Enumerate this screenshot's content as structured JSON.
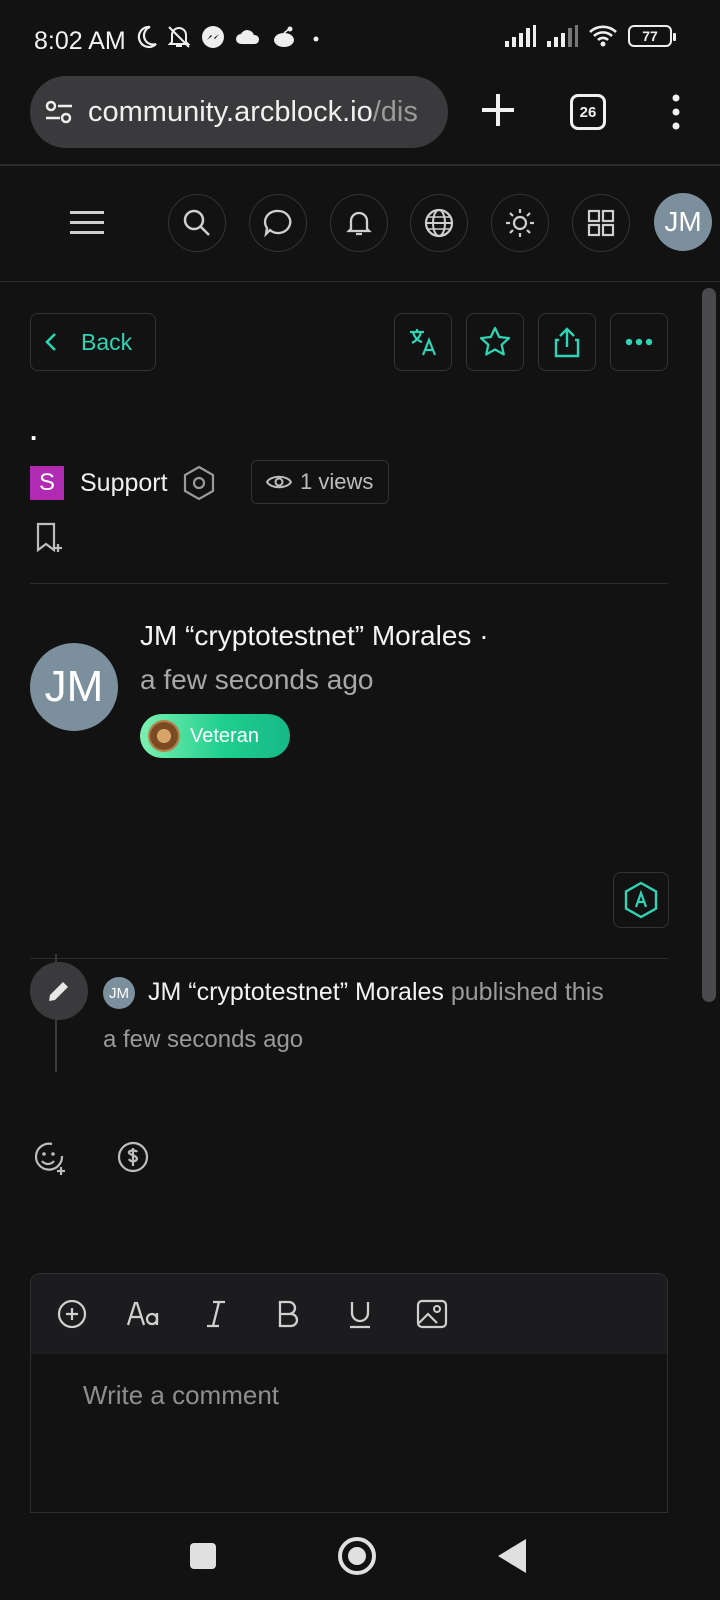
{
  "status_bar": {
    "time": "8:02 AM",
    "battery": "77",
    "icons": [
      "moon-icon",
      "bell-off-icon",
      "messenger-icon",
      "cloud-icon",
      "reddit-icon",
      "dot-icon",
      "signal-icon",
      "signal-icon",
      "wifi-icon",
      "battery-icon"
    ]
  },
  "browser": {
    "url_main": "community.arcblock.io",
    "url_path": "/dis",
    "tab_count": "26"
  },
  "header": {
    "avatar_initials": "JM",
    "icons": [
      "menu-icon",
      "search-icon",
      "chat-icon",
      "bell-icon",
      "globe-icon",
      "sun-icon",
      "apps-icon"
    ]
  },
  "actions": {
    "back_label": "Back",
    "icons": [
      "translate-icon",
      "star-icon",
      "share-icon",
      "more-icon"
    ]
  },
  "post": {
    "title": ".",
    "category_letter": "S",
    "category_name": "Support",
    "views": "1 views"
  },
  "author": {
    "initials": "JM",
    "name": "JM “cryptotestnet” Morales ·",
    "time": "a few seconds ago",
    "badge": "Veteran"
  },
  "timeline": {
    "avatar_initials": "JM",
    "actor": "JM “cryptotestnet” Morales",
    "action": " published this",
    "time": "a few seconds ago"
  },
  "editor": {
    "placeholder": "Write a comment",
    "tools": [
      "add-icon",
      "font-size-icon",
      "italic-icon",
      "bold-icon",
      "underline-icon",
      "image-icon"
    ]
  },
  "colors": {
    "accent": "#2fd4b4",
    "background": "#121213",
    "category": "#b02bb2",
    "avatar": "#7b8f9d"
  }
}
